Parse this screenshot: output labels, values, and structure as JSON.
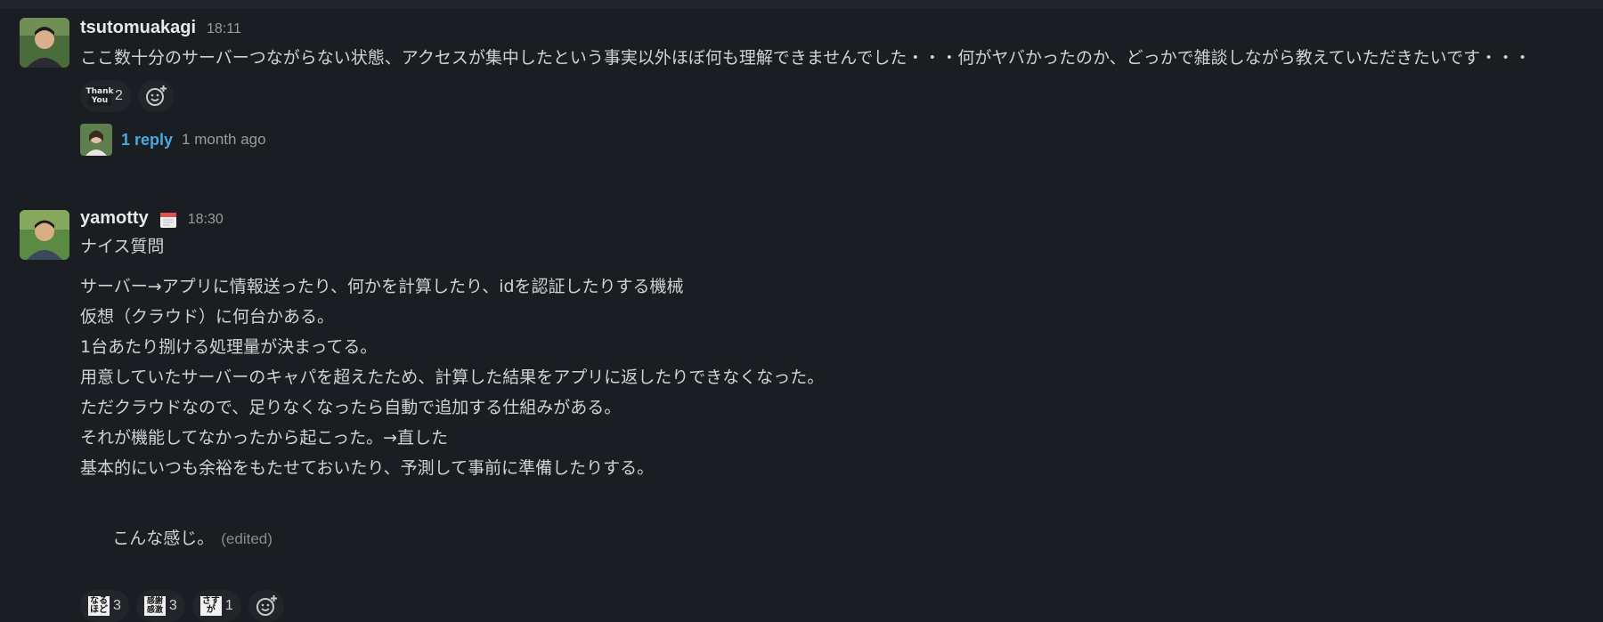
{
  "messages": [
    {
      "author": "tsutomuakagi",
      "time": "18:11",
      "avatar_icon": "user-photo-avatar",
      "text": "ここ数十分のサーバーつながらない状態、アクセスが集中したという事実以外ほぼ何も理解できませんでした・・・何がヤバかったのか、どっかで雑談しながら教えていただきたいです・・・",
      "reactions": [
        {
          "emoji_text": "Thank You",
          "emoji_icon": "thank-you-emoji",
          "count": "2"
        }
      ],
      "thread": {
        "reply_label": "1 reply",
        "reply_time": "1 month ago"
      }
    },
    {
      "author": "yamotty",
      "status_icon": "calendar-icon",
      "time": "18:30",
      "avatar_icon": "user-photo-avatar",
      "intro": "ナイス質問",
      "body_lines": [
        "サーバー→アプリに情報送ったり、何かを計算したり、idを認証したりする機械",
        "仮想（クラウド）に何台かある。",
        "1台あたり捌ける処理量が決まってる。",
        "用意していたサーバーのキャパを超えたため、計算した結果をアプリに返したりできなくなった。",
        "ただクラウドなので、足りなくなったら自動で追加する仕組みがある。",
        "それが機能してなかったから起こった。→直した",
        "基本的にいつも余裕をもたせておいたり、予測して事前に準備したりする。"
      ],
      "closing": "こんな感じ。",
      "edited_label": "(edited)",
      "reactions": [
        {
          "emoji_text": "なるほど",
          "emoji_icon": "naruhodo-emoji",
          "count": "3"
        },
        {
          "emoji_text": "感謝",
          "emoji_icon": "kansha-emoji",
          "count": "3"
        },
        {
          "emoji_text": "さすが",
          "emoji_icon": "sasuga-emoji",
          "count": "1"
        }
      ]
    }
  ],
  "colors": {
    "background": "#1a1d21",
    "link": "#4aa8e0",
    "text": "#d1d2d3"
  }
}
